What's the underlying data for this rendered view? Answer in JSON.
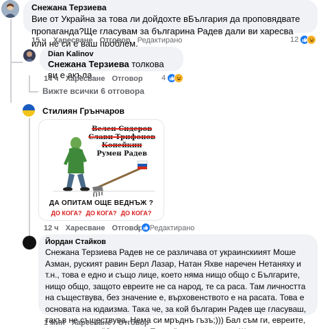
{
  "comments": [
    {
      "author": "Снежана Терзиева",
      "text": "Вие от Украйна за това ли дойдохте вБългария да проповядвате пропаганда?Ще гласувам за българина Радев дали ви харесва или не си е ваш проблем.",
      "time": "15 ч",
      "like": "Харесване",
      "reply": "Отговор",
      "edited": "Редактирано",
      "reaction_count": "12"
    },
    {
      "author": "Dian Kalinov",
      "mention": "Снежана Терзиева",
      "text": " толкова ви е акъла.",
      "time": "14 ч",
      "like": "Харесване",
      "reply": "Отговор",
      "reaction_count": "4"
    },
    {
      "view_replies": "Вижте всички 6 отговора"
    },
    {
      "author": "Стилиян Грънчаров",
      "time": "12 ч",
      "like": "Харесване",
      "reply": "Отговор",
      "edited": "Редактирано",
      "reaction_count": "1",
      "meme": {
        "names": [
          "Велен Сидеров",
          "Слави Трифонов",
          "Копейкин",
          "Румен Радев"
        ],
        "question": "ДА ОПИТАМ ОЩЕ ВЕДНЪЖ ?",
        "dokoga": [
          "ДО КОГА?",
          "ДО КОГА?",
          "ДО КОГА?"
        ]
      }
    },
    {
      "author": "Йордан Стайков",
      "text": "Снежана Терзиева Радев не се различава от украинскиият Моше Азман, руският равин Берл Лазар, Натан Яхве наречен Нетаняху и т.н., това е едно и също лице, което няма нищо общо с Българите, нищо общо, защото евреите не са народ, те са раса. Там личността на съществува, без значение е, върховенството е на расата. Това е основата на юдаизма. Така че, за кой българин Радев ще гласуваш, такъв не съществува. Нема си мръднъ гъзъ;))) Бал съм ги, евреите, да са оправат. \"Стената на Плача\" не е моят храм;)))",
      "time": "1 мин",
      "like": "Харесване",
      "reply": "Отговор"
    }
  ],
  "colors": {
    "like_blue": "#1877f2",
    "haha_yellow": "#f7b125",
    "bubble": "#f0f2f5",
    "meta": "#65676b"
  }
}
